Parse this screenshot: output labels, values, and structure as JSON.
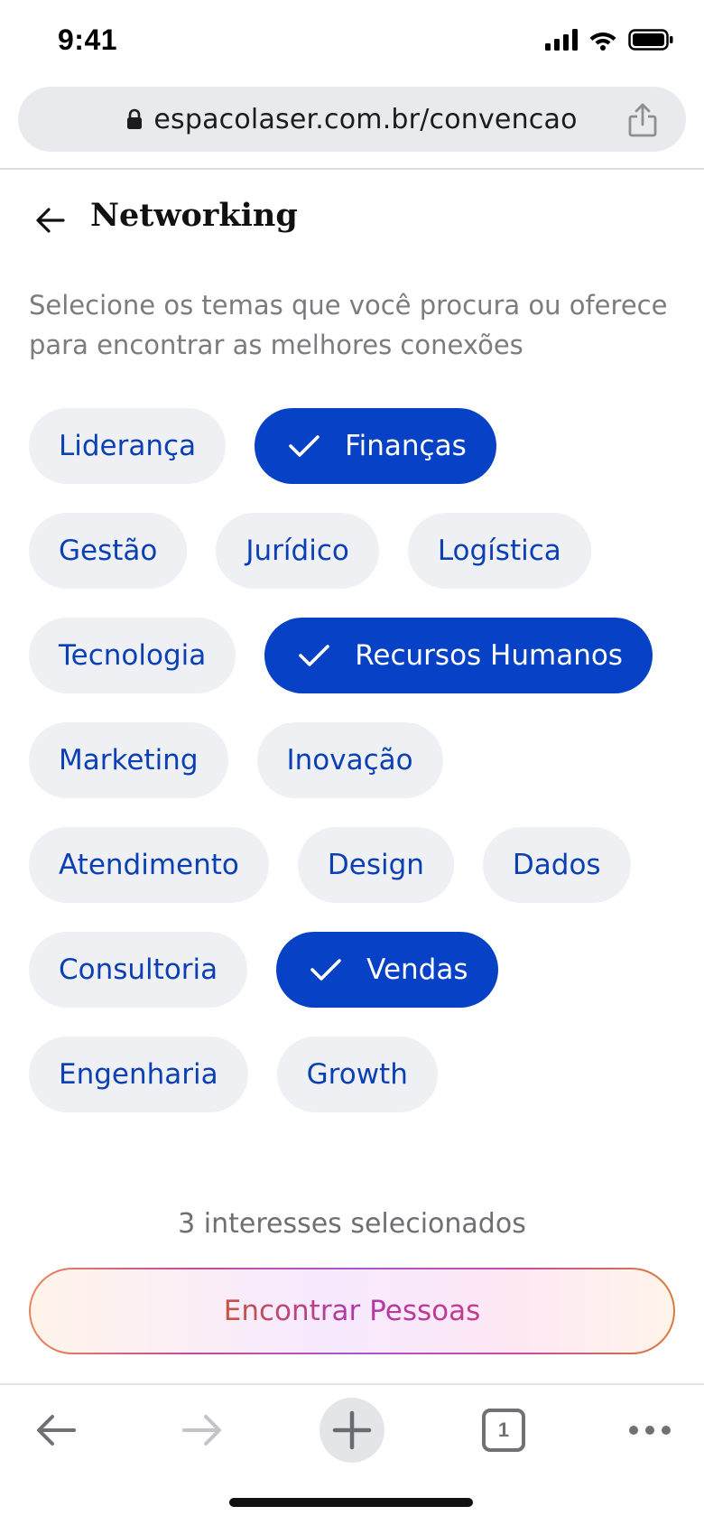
{
  "status_bar": {
    "time": "9:41",
    "icons": [
      "signal-icon",
      "wifi-icon",
      "battery-icon"
    ]
  },
  "browser": {
    "url": "espacolaser.com.br/convencao",
    "lock_icon": "lock-icon",
    "share_icon": "share-icon"
  },
  "header": {
    "back_icon": "arrow-left-icon",
    "title": "Networking"
  },
  "subtitle": "Selecione os temas que você procura ou oferece para encontrar as melhores conexões",
  "chips": [
    {
      "label": "Liderança",
      "selected": false
    },
    {
      "label": "Finanças",
      "selected": true
    },
    {
      "label": "Gestão",
      "selected": false
    },
    {
      "label": "Jurídico",
      "selected": false
    },
    {
      "label": "Logística",
      "selected": false
    },
    {
      "label": "Tecnologia",
      "selected": false
    },
    {
      "label": "Recursos Humanos",
      "selected": true
    },
    {
      "label": "Marketing",
      "selected": false
    },
    {
      "label": "Inovação",
      "selected": false
    },
    {
      "label": "Atendimento",
      "selected": false
    },
    {
      "label": "Design",
      "selected": false
    },
    {
      "label": "Dados",
      "selected": false
    },
    {
      "label": "Consultoria",
      "selected": false
    },
    {
      "label": "Vendas",
      "selected": true
    },
    {
      "label": "Engenharia",
      "selected": false
    },
    {
      "label": "Growth",
      "selected": false
    }
  ],
  "selection_summary": "3 interesses selecionados",
  "cta": {
    "label": "Encontrar Pessoas"
  },
  "toolbar": {
    "back_icon": "arrow-left-icon",
    "forward_icon": "arrow-right-icon",
    "new_tab_icon": "plus-icon",
    "tab_count": "1",
    "more_icon": "more-icon"
  },
  "colors": {
    "chip_bg": "#eef0f4",
    "chip_text": "#0b3fb4",
    "chip_selected_bg": "#0741c6",
    "chip_selected_text": "#ffffff"
  }
}
